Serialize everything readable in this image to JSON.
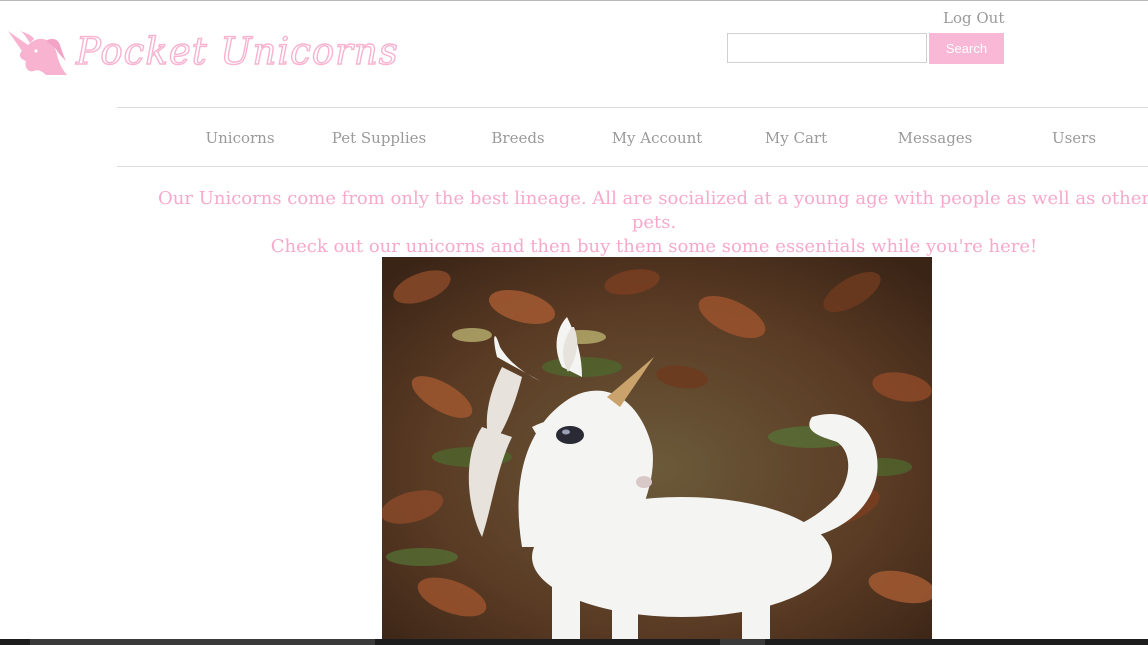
{
  "brand": {
    "name": "Pocket Unicorns",
    "icon": "unicorn-head-icon",
    "color": "#f7b3d0"
  },
  "header": {
    "logout_label": "Log Out",
    "search_placeholder": "",
    "search_value": "",
    "search_button_label": "Search"
  },
  "nav": {
    "items": [
      {
        "label": "Unicorns"
      },
      {
        "label": "Pet Supplies"
      },
      {
        "label": "Breeds"
      },
      {
        "label": "My Account"
      },
      {
        "label": "My Cart"
      },
      {
        "label": "Messages"
      },
      {
        "label": "Users"
      }
    ]
  },
  "intro": {
    "line1": "Our Unicorns come from only the best lineage. All are socialized at a young age with people as well as other pets.",
    "line2": "Check out our unicorns and then buy them some some essentials while you're here!",
    "color": "#f7a9cc"
  },
  "hero": {
    "image": "baby-unicorn-photo"
  },
  "colors": {
    "accent": "#f8b8d6",
    "nav_text": "#9a9a9a"
  }
}
